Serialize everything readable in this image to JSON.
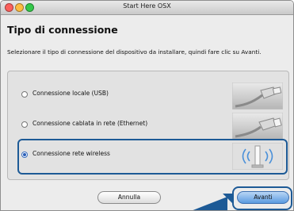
{
  "window": {
    "title": "Start Here OSX"
  },
  "heading": "Tipo di connessione",
  "instruction": "Selezionare il tipo di connessione del dispositivo da installare, quindi fare clic su Avanti.",
  "options": [
    {
      "label": "Connessione locale (USB)",
      "selected": false,
      "icon": "usb-cable-icon"
    },
    {
      "label": "Connessione cablata in rete (Ethernet)",
      "selected": false,
      "icon": "ethernet-cable-icon"
    },
    {
      "label": "Connessione rete wireless",
      "selected": true,
      "icon": "wireless-signal-icon"
    }
  ],
  "buttons": {
    "cancel": "Annulla",
    "next": "Avanti"
  },
  "colors": {
    "highlight": "#1d5a96",
    "accent_button": "#5b9be0"
  }
}
